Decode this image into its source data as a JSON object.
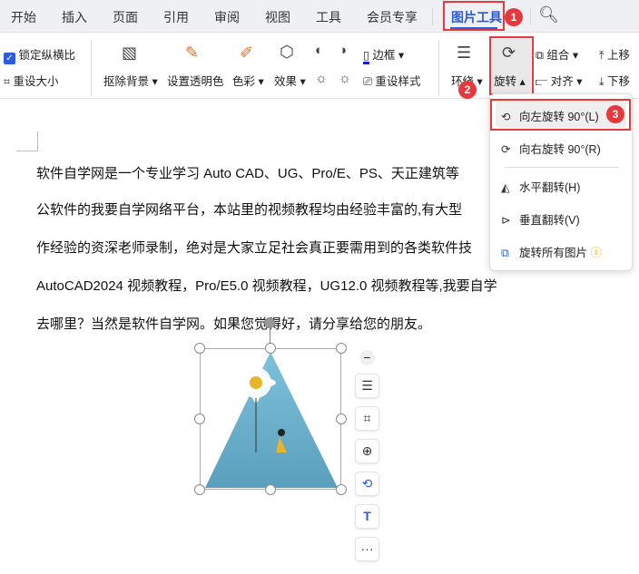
{
  "tabs": [
    "开始",
    "插入",
    "页面",
    "引用",
    "审阅",
    "视图",
    "工具",
    "会员专享",
    "图片工具"
  ],
  "badges": [
    "1",
    "2",
    "3"
  ],
  "ribbon": {
    "lock_ratio": "锁定纵横比",
    "reset_size": "重设大小",
    "remove_bg": "抠除背景",
    "set_transparent": "设置透明色",
    "color": "色彩",
    "effects": "效果",
    "border": "边框",
    "reset_style": "重设样式",
    "wrap": "环绕",
    "rotate": "旋转",
    "group": "组合",
    "align": "对齐",
    "move_up": "上移",
    "move_down": "下移"
  },
  "menu": {
    "rotate_left": "向左旋转 90°(L)",
    "rotate_right": "向右旋转 90°(R)",
    "flip_h": "水平翻转(H)",
    "flip_v": "垂直翻转(V)",
    "rotate_all": "旋转所有图片"
  },
  "doc": [
    "软件自学网是一个专业学习 Auto CAD、UG、Pro/E、PS、天正建筑等",
    "公软件的我要自学网络平台，本站里的视频教程均由经验丰富的,有大型",
    "作经验的资深老师录制，绝对是大家立足社会真正要需用到的各类软件技",
    "AutoCAD2024 视频教程，Pro/E5.0 视频教程，UG12.0 视频教程等,我要自学",
    "去哪里？当然是软件自学网。如果您觉得好，请分享给您的朋友。"
  ],
  "colors": {
    "accent": "#2a5cdb",
    "highlight": "#e8383b"
  }
}
